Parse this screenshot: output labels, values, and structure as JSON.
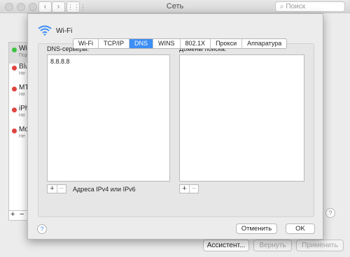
{
  "window": {
    "title": "Сеть",
    "search_placeholder": "Поиск"
  },
  "services": [
    {
      "name": "Wi-Fi",
      "status": "Под",
      "dot": "#3ec43e"
    },
    {
      "name": "Blue",
      "status": "Не",
      "dot": "#e0443e"
    },
    {
      "name": "MT",
      "status": "Не",
      "dot": "#e0443e"
    },
    {
      "name": "iPh",
      "status": "Не",
      "dot": "#e0443e"
    },
    {
      "name": "Mo",
      "status": "Не",
      "dot": "#e0443e"
    }
  ],
  "bottom": {
    "assistant": "Ассистент...",
    "revert": "Вернуть",
    "apply": "Применить"
  },
  "sheet": {
    "interface": "Wi-Fi",
    "tabs": [
      "Wi-Fi",
      "TCP/IP",
      "DNS",
      "WINS",
      "802.1X",
      "Прокси",
      "Аппаратура"
    ],
    "active_tab": "DNS",
    "dns_label": "DNS-серверы:",
    "dns_servers": [
      "8.8.8.8"
    ],
    "search_label": "Домены поиска:",
    "hint": "Адреса IPv4 или IPv6",
    "cancel": "Отменить",
    "ok": "OK",
    "help": "?"
  },
  "colors": {
    "accent": "#3c8ef5"
  }
}
